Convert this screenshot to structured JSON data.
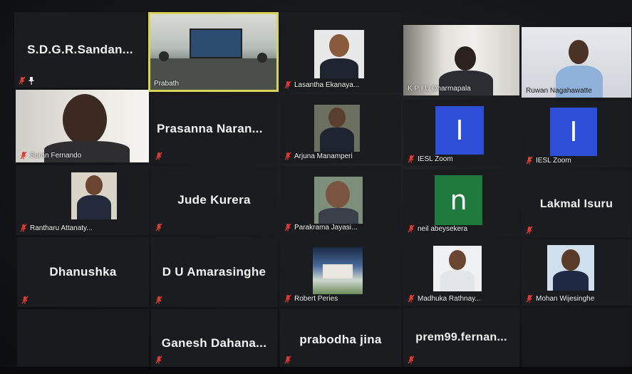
{
  "participants": [
    {
      "name": "S.D.G.R.Sandan...",
      "pinned": true
    },
    {
      "name": "Prabath"
    },
    {
      "name": "Lasantha Ekanaya..."
    },
    {
      "name": "K P I U Dharmapala"
    },
    {
      "name": "Ruwan Nagahawatte"
    },
    {
      "name": "Suran Fernando"
    },
    {
      "name": "Prasanna  Naran..."
    },
    {
      "name": "Arjuna Manamperi"
    },
    {
      "name": "IESL Zoom",
      "avatar_letter": "I",
      "avatar_color": "#2d4fd8"
    },
    {
      "name": "IESL Zoom",
      "avatar_letter": "I",
      "avatar_color": "#2d4fd8"
    },
    {
      "name": "Rantharu Attanaty..."
    },
    {
      "name": "Jude Kurera"
    },
    {
      "name": "Parakrama Jayasi..."
    },
    {
      "name": "neil abeysekera",
      "avatar_letter": "n",
      "avatar_color": "#1f7a3d"
    },
    {
      "name": "Lakmal Isuru"
    },
    {
      "name": "Dhanushka"
    },
    {
      "name": "D U Amarasinghe"
    },
    {
      "name": "Robert Peries"
    },
    {
      "name": "Madhuka Rathnay..."
    },
    {
      "name": "Mohan Wijesinghe"
    },
    {
      "name": "Ganesh  Dahana..."
    },
    {
      "name": "prabodha jina"
    },
    {
      "name": "prem99.fernan..."
    }
  ],
  "colors": {
    "muted_icon": "#e23a2e",
    "active_speaker_border": "#d8d45a"
  },
  "icons": {
    "muted": "microphone-muted-icon",
    "pinned": "pin-icon"
  }
}
